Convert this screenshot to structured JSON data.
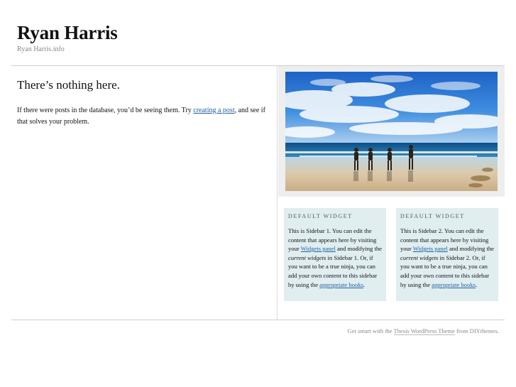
{
  "header": {
    "site_title": "Ryan Harris",
    "tagline": "Ryan Harris.info"
  },
  "content": {
    "headline": "There’s nothing here.",
    "text_before_link": "If there were posts in the database, you’d be seeing them. Try ",
    "link_text": "creating a post",
    "text_after_link": ", and see if that solves your problem."
  },
  "widgets": [
    {
      "title": "Default Widget",
      "text_1": "This is Sidebar 1. You can edit the content that appears here by visiting your ",
      "link_1": "Widgets panel",
      "text_2": " and modifying the ",
      "emphasis": "current widgets",
      "text_3": " in Sidebar 1. Or, if you want to be a true ninja, you can add your own content to this sidebar by using the ",
      "link_2": "appropriate hooks",
      "text_4": "."
    },
    {
      "title": "Default Widget",
      "text_1": "This is Sidebar 2. You can edit the content that appears here by visiting your ",
      "link_1": "Widgets panel",
      "text_2": " and modifying the ",
      "emphasis": "current widgets",
      "text_3": " in Sidebar 2. Or, if you want to be a true ninja, you can add your own content to this sidebar by using the ",
      "link_2": "appropriate hooks",
      "text_4": "."
    }
  ],
  "footer": {
    "text_before": "Get smart with the ",
    "link_text": "Thesis WordPress Theme",
    "text_after": " from DIYthemes."
  }
}
